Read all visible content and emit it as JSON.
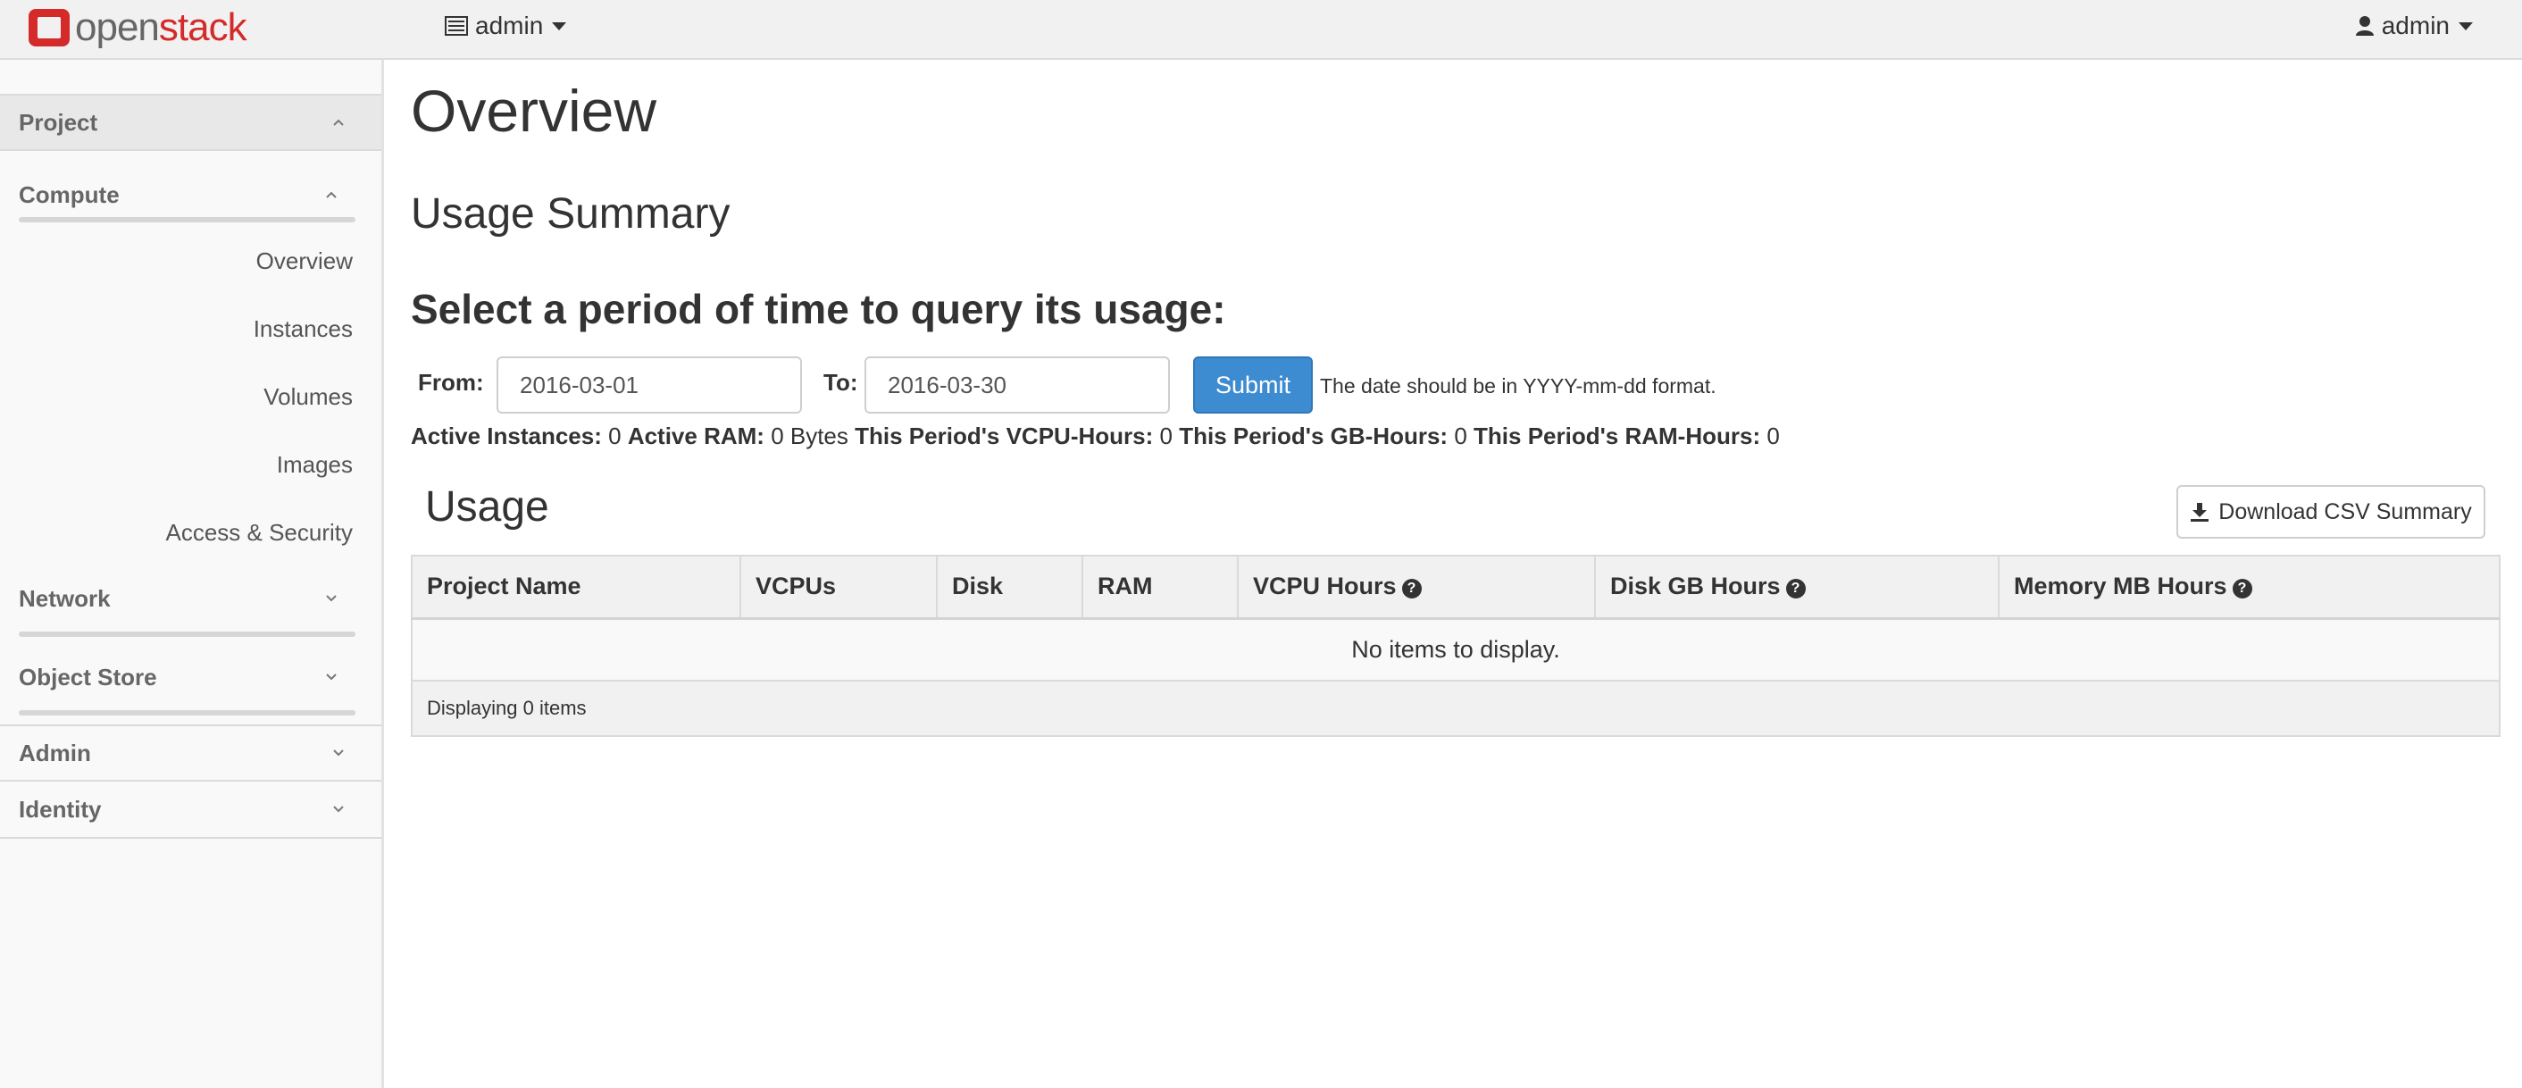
{
  "brand": {
    "part1": "open",
    "part2": "stack"
  },
  "header": {
    "project_switcher": "admin",
    "user_menu": "admin"
  },
  "sidebar": {
    "project": "Project",
    "compute": "Compute",
    "compute_items": [
      "Overview",
      "Instances",
      "Volumes",
      "Images",
      "Access & Security"
    ],
    "network": "Network",
    "object_store": "Object Store",
    "admin": "Admin",
    "identity": "Identity"
  },
  "main": {
    "title": "Overview",
    "usage_summary": "Usage Summary",
    "period_heading": "Select a period of time to query its usage:",
    "from_label": "From:",
    "from_value": "2016-03-01",
    "to_label": "To:",
    "to_value": "2016-03-30",
    "submit": "Submit",
    "hint": "The date should be in YYYY-mm-dd format.",
    "stats": {
      "instances_label": "Active Instances:",
      "instances": "0",
      "ram_label": "Active RAM:",
      "ram": "0 Bytes",
      "vcpu_label": "This Period's VCPU-Hours:",
      "vcpu": "0",
      "gb_label": "This Period's GB-Hours:",
      "gb": "0",
      "ramh_label": "This Period's RAM-Hours:",
      "ramh": "0"
    },
    "usage_heading": "Usage",
    "csv_button": "Download CSV Summary",
    "table": {
      "columns": [
        "Project Name",
        "VCPUs",
        "Disk",
        "RAM",
        "VCPU Hours",
        "Disk GB Hours",
        "Memory MB Hours"
      ],
      "empty": "No items to display.",
      "footer": "Displaying 0 items"
    }
  },
  "colors": {
    "brand_red": "#d42a2a",
    "primary": "#3d8bd1"
  }
}
